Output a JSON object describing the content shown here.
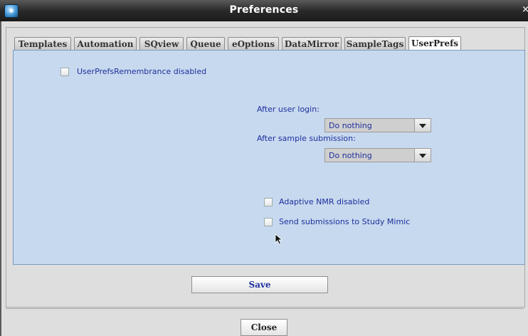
{
  "window": {
    "title": "Preferences",
    "close_symbol": "×"
  },
  "tabs": [
    {
      "label": "Templates",
      "active": false
    },
    {
      "label": "Automation",
      "active": false
    },
    {
      "label": "SQview",
      "active": false
    },
    {
      "label": "Queue",
      "active": false
    },
    {
      "label": "eOptions",
      "active": false
    },
    {
      "label": "DataMirror",
      "active": false
    },
    {
      "label": "SampleTags",
      "active": false
    },
    {
      "label": "UserPrefs",
      "active": true
    }
  ],
  "userprefs": {
    "remembrance": {
      "label": "UserPrefsRemembrance disabled",
      "checked": false
    },
    "after_login": {
      "label": "After user login:",
      "value": "Do nothing"
    },
    "after_submission": {
      "label": "After sample submission:",
      "value": "Do nothing"
    },
    "adaptive_nmr": {
      "label": "Adaptive NMR disabled",
      "checked": false
    },
    "send_mimic": {
      "label": "Send submissions to Study Mimic",
      "checked": false
    }
  },
  "buttons": {
    "save": "Save",
    "close": "Close"
  },
  "colors": {
    "panel": "#c7d9ee",
    "label_text": "#1e2f9e"
  }
}
